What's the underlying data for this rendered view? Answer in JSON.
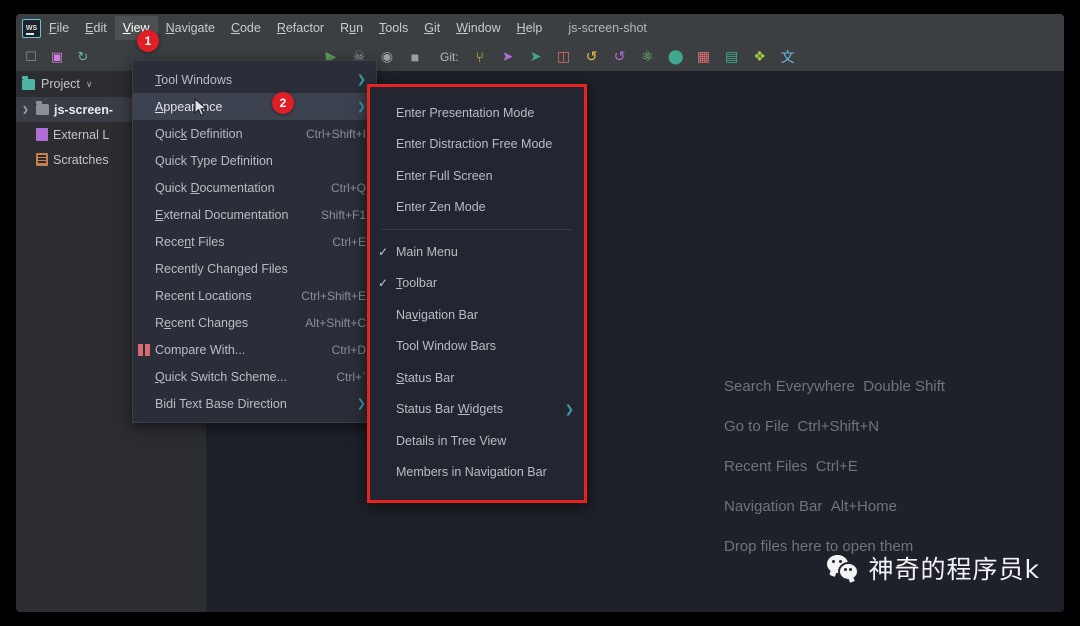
{
  "window": {
    "app": "WebStorm",
    "logo_text": "WS",
    "project_title": "js-screen-shot"
  },
  "menubar": {
    "items": [
      {
        "label": "File",
        "mnemonic": "F",
        "active": false
      },
      {
        "label": "Edit",
        "mnemonic": "E",
        "active": false
      },
      {
        "label": "View",
        "mnemonic": "V",
        "active": true
      },
      {
        "label": "Navigate",
        "mnemonic": "N",
        "active": false
      },
      {
        "label": "Code",
        "mnemonic": "C",
        "active": false
      },
      {
        "label": "Refactor",
        "mnemonic": "R",
        "active": false
      },
      {
        "label": "Run",
        "mnemonic": "u",
        "active": false
      },
      {
        "label": "Tools",
        "mnemonic": "T",
        "active": false
      },
      {
        "label": "Git",
        "mnemonic": "G",
        "active": false
      },
      {
        "label": "Window",
        "mnemonic": "W",
        "active": false
      },
      {
        "label": "Help",
        "mnemonic": "H",
        "active": false
      }
    ]
  },
  "toolbar": {
    "left_icons": [
      {
        "name": "open-folder-icon",
        "glyph": "☐",
        "color": "#8b8f96"
      },
      {
        "name": "save-all-icon",
        "glyph": "▣",
        "color": "#d07fe0"
      },
      {
        "name": "sync-refresh-icon",
        "glyph": "↻",
        "color": "#5fb8a8"
      }
    ],
    "git_label": "Git:",
    "right_icons": [
      {
        "name": "run-icon",
        "glyph": "▶",
        "color": "#5a9e5a"
      },
      {
        "name": "debug-icon",
        "glyph": "☠",
        "color": "#9aa0a6"
      },
      {
        "name": "run-with-coverage-icon",
        "glyph": "◉",
        "color": "#9aa0a6"
      },
      {
        "name": "stop-icon",
        "glyph": "■",
        "color": "#9aa0a6"
      },
      {
        "name": "git-branch-icon",
        "glyph": "⑂",
        "color": "#e8c547"
      },
      {
        "name": "git-push-icon",
        "glyph": "➤",
        "color": "#b06fd6"
      },
      {
        "name": "git-update-icon",
        "glyph": "➤",
        "color": "#3fa88f"
      },
      {
        "name": "compare-icon",
        "glyph": "◫",
        "color": "#d86b6b"
      },
      {
        "name": "history-icon",
        "glyph": "↺",
        "color": "#e8c547"
      },
      {
        "name": "rollback-icon",
        "glyph": "↺",
        "color": "#b06fd6"
      },
      {
        "name": "atom-icon",
        "glyph": "⚛",
        "color": "#7fc97f"
      },
      {
        "name": "search-target-icon",
        "glyph": "⬤",
        "color": "#3fa88f"
      },
      {
        "name": "layout-icon",
        "glyph": "▦",
        "color": "#e06c75"
      },
      {
        "name": "database-icon",
        "glyph": "▤",
        "color": "#3fa88f"
      },
      {
        "name": "plugin-puzzle-icon",
        "glyph": "❖",
        "color": "#9ecb3f"
      },
      {
        "name": "translate-icon",
        "glyph": "文",
        "color": "#6bb8e0"
      }
    ]
  },
  "project_pane": {
    "header": {
      "label": "Project",
      "icon": "project-folder-icon",
      "chevron": "∨"
    },
    "tree": [
      {
        "label": "js-screen-",
        "icon": "folder-icon",
        "arrow": "❯",
        "selected": true,
        "bold": true
      },
      {
        "label": "External L",
        "icon": "library-icon",
        "arrow": "",
        "selected": false,
        "bold": false
      },
      {
        "label": "Scratches",
        "icon": "scratches-icon",
        "arrow": "",
        "selected": false,
        "bold": false
      }
    ]
  },
  "view_menu": {
    "items": [
      {
        "label": "Tool Windows",
        "mnemonic": "T",
        "shortcut": "",
        "arrow": true,
        "icon": "",
        "highlighted": false
      },
      {
        "label": "Appearance",
        "mnemonic": "A",
        "shortcut": "",
        "arrow": true,
        "icon": "",
        "highlighted": true
      },
      {
        "label": "Quick Definition",
        "mnemonic": "k",
        "shortcut": "Ctrl+Shift+I",
        "arrow": false,
        "icon": "",
        "highlighted": false
      },
      {
        "label": "Quick Type Definition",
        "mnemonic": "",
        "shortcut": "",
        "arrow": false,
        "icon": "",
        "highlighted": false
      },
      {
        "label": "Quick Documentation",
        "mnemonic": "D",
        "shortcut": "Ctrl+Q",
        "arrow": false,
        "icon": "",
        "highlighted": false
      },
      {
        "label": "External Documentation",
        "mnemonic": "E",
        "shortcut": "Shift+F1",
        "arrow": false,
        "icon": "",
        "highlighted": false
      },
      {
        "label": "Recent Files",
        "mnemonic": "n",
        "shortcut": "Ctrl+E",
        "arrow": false,
        "icon": "",
        "highlighted": false
      },
      {
        "label": "Recently Changed Files",
        "mnemonic": "",
        "shortcut": "",
        "arrow": false,
        "icon": "",
        "highlighted": false
      },
      {
        "label": "Recent Locations",
        "mnemonic": "",
        "shortcut": "Ctrl+Shift+E",
        "arrow": false,
        "icon": "",
        "highlighted": false
      },
      {
        "label": "Recent Changes",
        "mnemonic": "e",
        "shortcut": "Alt+Shift+C",
        "arrow": false,
        "icon": "",
        "highlighted": false
      },
      {
        "label": "Compare With...",
        "mnemonic": "",
        "shortcut": "Ctrl+D",
        "arrow": false,
        "icon": "compare-with-icon",
        "highlighted": false
      },
      {
        "label": "Quick Switch Scheme...",
        "mnemonic": "Q",
        "shortcut": "Ctrl+`",
        "arrow": false,
        "icon": "",
        "highlighted": false
      },
      {
        "label": "Bidi Text Base Direction",
        "mnemonic": "",
        "shortcut": "",
        "arrow": true,
        "icon": "",
        "highlighted": false
      }
    ]
  },
  "appearance_submenu": {
    "items": [
      {
        "label": "Enter Presentation Mode",
        "checked": false,
        "arrow": false,
        "mnemonic": ""
      },
      {
        "label": "Enter Distraction Free Mode",
        "checked": false,
        "arrow": false,
        "mnemonic": ""
      },
      {
        "label": "Enter Full Screen",
        "checked": false,
        "arrow": false,
        "mnemonic": ""
      },
      {
        "label": "Enter Zen Mode",
        "checked": false,
        "arrow": false,
        "mnemonic": ""
      },
      {
        "separator": true
      },
      {
        "label": "Main Menu",
        "checked": true,
        "arrow": false,
        "mnemonic": ""
      },
      {
        "label": "Toolbar",
        "checked": true,
        "arrow": false,
        "mnemonic": "T"
      },
      {
        "label": "Navigation Bar",
        "checked": false,
        "arrow": false,
        "mnemonic": "v"
      },
      {
        "label": "Tool Window Bars",
        "checked": false,
        "arrow": false,
        "mnemonic": ""
      },
      {
        "label": "Status Bar",
        "checked": false,
        "arrow": false,
        "mnemonic": "S"
      },
      {
        "label": "Status Bar Widgets",
        "checked": false,
        "arrow": true,
        "mnemonic": "W"
      },
      {
        "label": "Details in Tree View",
        "checked": false,
        "arrow": false,
        "mnemonic": ""
      },
      {
        "label": "Members in Navigation Bar",
        "checked": false,
        "arrow": false,
        "mnemonic": ""
      }
    ],
    "highlight_color": "#e8231f"
  },
  "editor_hints": [
    {
      "action": "Search Everywhere",
      "shortcut": "Double Shift"
    },
    {
      "action": "Go to File",
      "shortcut": "Ctrl+Shift+N"
    },
    {
      "action": "Recent Files",
      "shortcut": "Ctrl+E"
    },
    {
      "action": "Navigation Bar",
      "shortcut": "Alt+Home"
    },
    {
      "action": "Drop files here to open them",
      "shortcut": ""
    }
  ],
  "annotations": [
    {
      "number": "1",
      "name": "step-badge-1"
    },
    {
      "number": "2",
      "name": "step-badge-2"
    }
  ],
  "watermark": {
    "text": "神奇的程序员k",
    "icon": "wechat-icon"
  },
  "colors": {
    "accent_red": "#e8231f",
    "badge_red": "#e01e26",
    "menu_bg": "#2b2d38",
    "submenu_bg": "#232630",
    "editor_bg": "#1e2129",
    "chrome_bg": "#3c3f41",
    "pane_bg": "#2b2d30"
  }
}
